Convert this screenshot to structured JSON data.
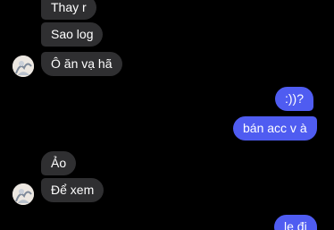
{
  "conversation": {
    "messages": [
      {
        "direction": "incoming",
        "text": "Thay r"
      },
      {
        "direction": "incoming",
        "text": "Sao log"
      },
      {
        "direction": "incoming",
        "text": "Ô ăn vạ hã"
      },
      {
        "direction": "outgoing",
        "text": ":))?"
      },
      {
        "direction": "outgoing",
        "text": "bán acc v à"
      },
      {
        "direction": "incoming",
        "text": "Ảo"
      },
      {
        "direction": "incoming",
        "text": "Để xem"
      },
      {
        "direction": "outgoing",
        "text": "le đi"
      }
    ]
  },
  "colors": {
    "background": "#000000",
    "incoming_bubble": "#2f2f31",
    "outgoing_bubble": "#4f5cf1",
    "text": "#ffffff"
  },
  "icons": {
    "avatar": "sender-avatar-icon"
  }
}
